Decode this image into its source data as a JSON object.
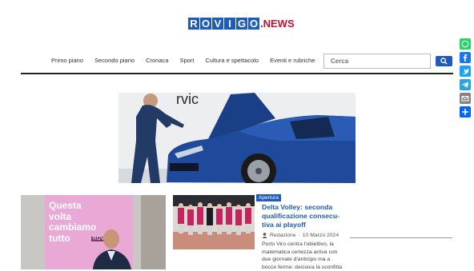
{
  "logo": {
    "letters": [
      "R",
      "O",
      "V",
      "I",
      "G",
      "O"
    ],
    "dot": ".",
    "suffix": "NEWS",
    "brand_color": "#1f5bb8",
    "accent_color": "#c8102e"
  },
  "nav": {
    "items": [
      "Primo piano",
      "Secondo piano",
      "Cronaca",
      "Sport",
      "Cultura e spettacolo",
      "Eventi e rubriche"
    ]
  },
  "search": {
    "placeholder": "Cerca",
    "button_icon": "search-icon"
  },
  "left_article": {
    "screen_text_lines": [
      "Questa",
      "volta",
      "cambiamo",
      "tutto"
    ],
    "screen_logo": "ROVIGO"
  },
  "featured": {
    "tag": "Apertura",
    "title": "Delta Volley: seconda qualificazione consecu-tiva ai playoff",
    "author": "Redazione",
    "date": "10 Marzo 2024",
    "excerpt": "Porto Viro centra l'obiettivo, la matematica certezza arriva con due giornate d'anticipo ma a bocce ferme: decisiva la sconfitta"
  },
  "share": {
    "buttons": [
      {
        "name": "whatsapp-icon",
        "color": "#25d366"
      },
      {
        "name": "facebook-icon",
        "color": "#1877f2"
      },
      {
        "name": "twitter-icon",
        "color": "#1da1f2"
      },
      {
        "name": "telegram-icon",
        "color": "#2aa5e0"
      },
      {
        "name": "email-icon",
        "color": "#848484"
      },
      {
        "name": "share-icon",
        "color": "#0166ff"
      }
    ]
  }
}
